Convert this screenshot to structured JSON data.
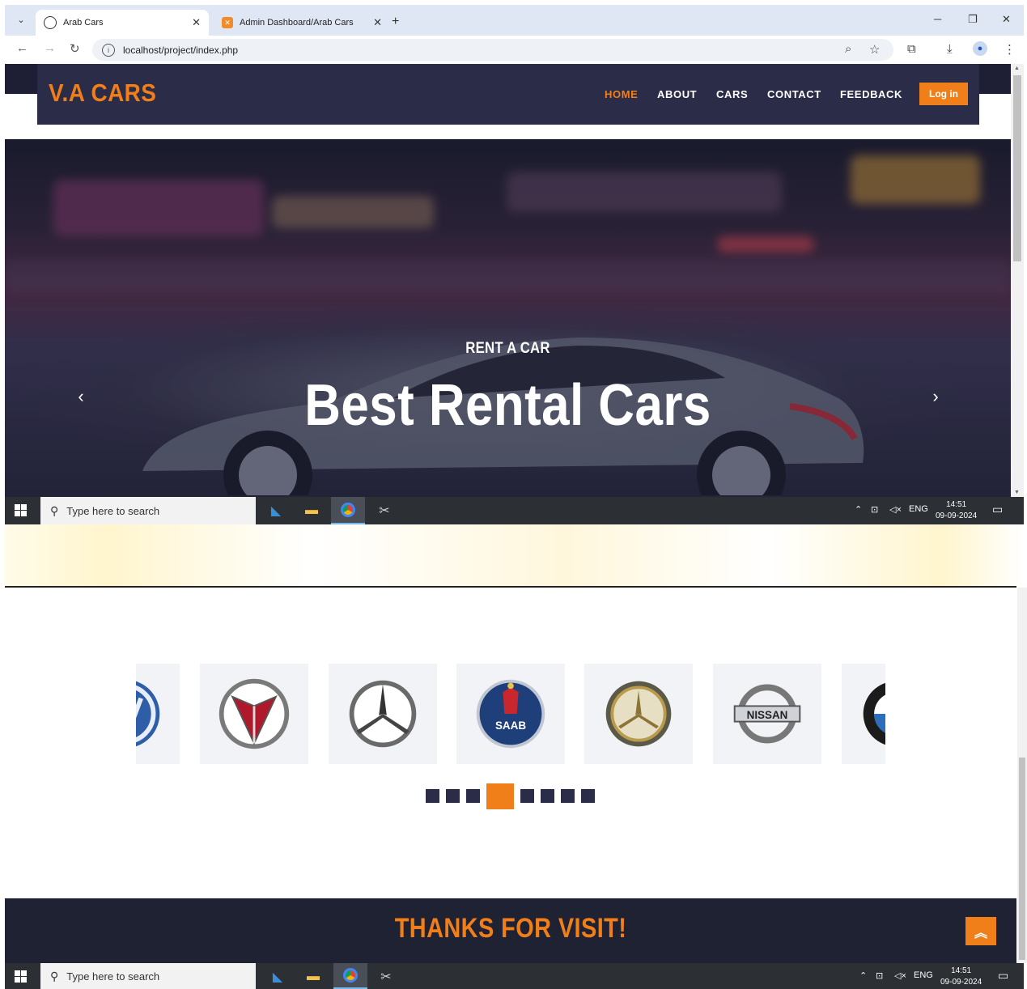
{
  "browser": {
    "tabs": [
      {
        "title": "Arab Cars",
        "active": true
      },
      {
        "title": "Admin Dashboard/Arab Cars",
        "active": false
      }
    ],
    "url": "localhost/project/index.php",
    "new_tab_symbol": "+",
    "close_symbol": "✕"
  },
  "site": {
    "brand": "V.A CARS",
    "nav": [
      "HOME",
      "ABOUT",
      "CARS",
      "CONTACT",
      "FEEDBACK"
    ],
    "active_nav": "HOME",
    "login_label": "Log in",
    "accent_color": "#f07f1a",
    "nav_bg_color": "#2b2c47"
  },
  "hero": {
    "subtitle": "RENT A CAR",
    "title": "Best Rental Cars",
    "prev_icon": "chevron-left-icon",
    "next_icon": "chevron-right-icon"
  },
  "brands_carousel": {
    "logos": [
      "volkswagen-logo",
      "pontiac-logo",
      "mercedes-logo",
      "saab-logo",
      "mercedes-benz-logo",
      "nissan-logo",
      "bmw-logo"
    ],
    "logo_text": {
      "saab": "SAAB",
      "nissan": "NISSAN"
    },
    "page_count": 8,
    "active_page_index": 3
  },
  "footer": {
    "text": "THANKS FOR VISIT!",
    "scroll_top_icon": "double-chevron-up-icon"
  },
  "taskbar": {
    "search_placeholder": "Type here to search",
    "language": "ENG",
    "time": "14:51",
    "date": "09-09-2024"
  }
}
